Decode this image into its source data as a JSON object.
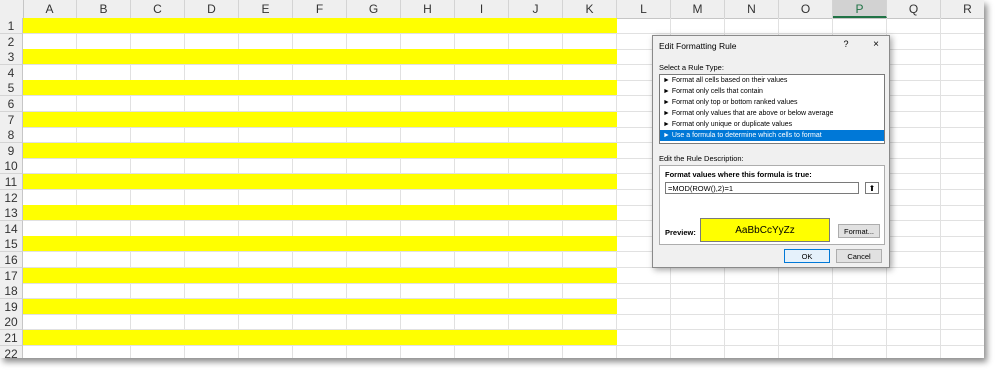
{
  "spreadsheet": {
    "columns": [
      "A",
      "B",
      "C",
      "D",
      "E",
      "F",
      "G",
      "H",
      "I",
      "J",
      "K",
      "L",
      "M",
      "N",
      "O",
      "P",
      "Q",
      "R"
    ],
    "selected_column": "P",
    "rows": [
      "1",
      "2",
      "3",
      "4",
      "5",
      "6",
      "7",
      "8",
      "9",
      "10",
      "11",
      "12",
      "13",
      "14",
      "15",
      "16",
      "17",
      "18",
      "19",
      "20",
      "21",
      "22"
    ],
    "highlight_color": "#ffff00",
    "highlighted_rows": [
      "1",
      "3",
      "5",
      "7",
      "9",
      "11",
      "13",
      "15",
      "17",
      "19",
      "21"
    ]
  },
  "dialog": {
    "title": "Edit Formatting Rule",
    "help_label": "?",
    "close_label": "×",
    "select_rule_type_label": "Select a Rule Type:",
    "rule_types": [
      "► Format all cells based on their values",
      "► Format only cells that contain",
      "► Format only top or bottom ranked values",
      "► Format only values that are above or below average",
      "► Format only unique or duplicate values",
      "► Use a formula to determine which cells to format"
    ],
    "selected_rule_index": 5,
    "edit_description_label": "Edit the Rule Description:",
    "formula_label": "Format values where this formula is true:",
    "formula_value": "=MOD(ROW(),2)=1",
    "preview_label": "Preview:",
    "preview_text": "AaBbCcYyZz",
    "preview_color": "#ffff00",
    "format_button": "Format...",
    "ok_button": "OK",
    "cancel_button": "Cancel"
  }
}
